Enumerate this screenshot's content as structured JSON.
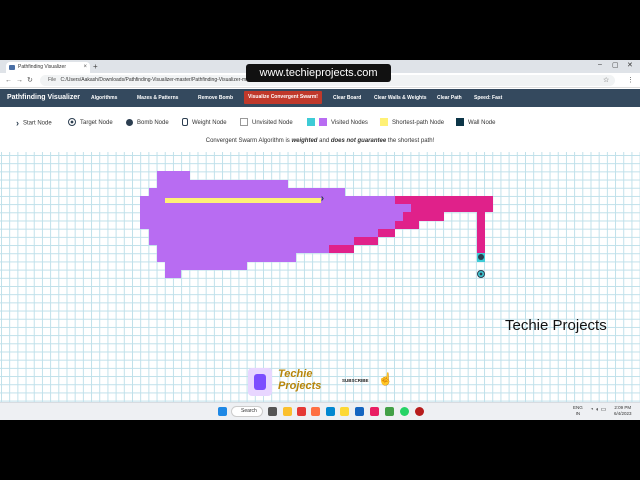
{
  "watermark": "www.techieprojects.com",
  "browser": {
    "tab_title": "Pathfinding Visualizer",
    "new_tab": "+",
    "close_tab": "×",
    "url_prefix": "File",
    "url": "C:/Users/Aakash/Downloads/Pathfinding-Visualizer-master/Pathfinding-Visualizer-master/"
  },
  "navbar": {
    "brand": "Pathfinding Visualizer",
    "items": [
      "Algorithms",
      "Mazes & Patterns",
      "Remove Bomb",
      "Visualize Convergent Swarm!",
      "Clear Board",
      "Clear Walls & Weights",
      "Clear Path",
      "Speed: Fast"
    ]
  },
  "legend": {
    "items": [
      "Start Node",
      "Target Node",
      "Bomb Node",
      "Weight Node",
      "Unvisited Node",
      "Visited Nodes",
      "Shortest-path Node",
      "Wall Node"
    ]
  },
  "info": {
    "prefix": "Convergent Swarm Algorithm is ",
    "weighted": "weighted",
    "middle": " and ",
    "not_guarantee": "does not guarantee",
    "suffix": " the shortest path!"
  },
  "overlay": {
    "channel_text": "Techie Projects",
    "logo_line1": "Techie",
    "logo_line2": "Projects",
    "subscribe": "SUBSCRIBE"
  },
  "taskbar": {
    "search": "Search",
    "lang_top": "ENG",
    "lang_bottom": "IN",
    "time": "2:09 PM",
    "date": "6/4/2023"
  },
  "colors": {
    "visited": "#b86cf2",
    "frontier": "#e0218a",
    "shortest_path": "#fff176",
    "navbar": "#34495e",
    "active_button": "#c0392b",
    "grid_line": "#bfe0ea",
    "wall": "#0c3547"
  }
}
